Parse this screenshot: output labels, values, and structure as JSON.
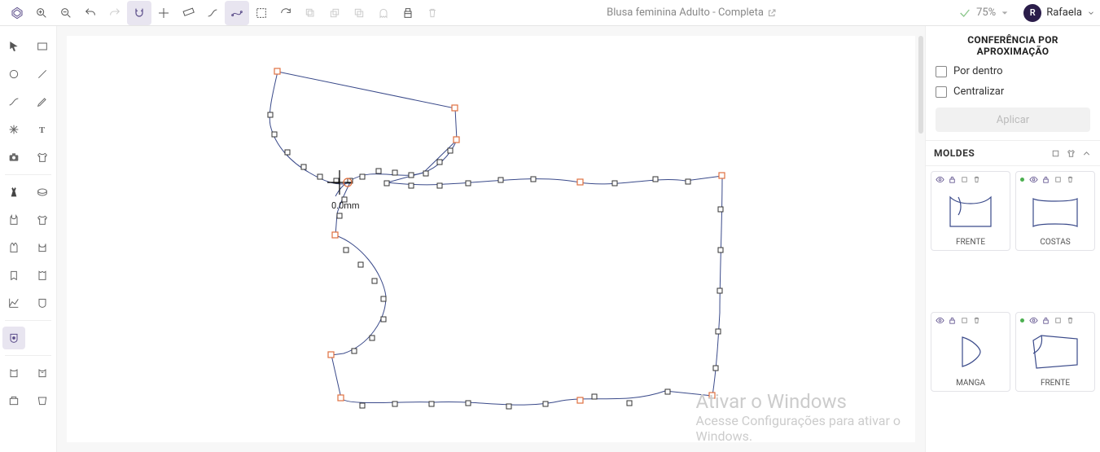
{
  "header": {
    "doc_title": "Blusa feminina Adulto - Completa",
    "zoom": "75%",
    "user_initial": "R",
    "user_name": "Rafaela"
  },
  "canvas": {
    "measurement_label": "0.0mm"
  },
  "conference_panel": {
    "title_line1": "CONFERÊNCIA POR",
    "title_line2": "APROXIMAÇÃO",
    "option_inside": "Por dentro",
    "option_center": "Centralizar",
    "apply_label": "Aplicar"
  },
  "moldes": {
    "title": "MOLDES",
    "items": [
      {
        "label": "FRENTE",
        "has_dot": false
      },
      {
        "label": "COSTAS",
        "has_dot": true
      },
      {
        "label": "MANGA",
        "has_dot": false
      },
      {
        "label": "FRENTE",
        "has_dot": true
      }
    ]
  },
  "watermark": {
    "line1": "Ativar o Windows",
    "line2": "Acesse Configurações para ativar o",
    "line3": "Windows."
  }
}
